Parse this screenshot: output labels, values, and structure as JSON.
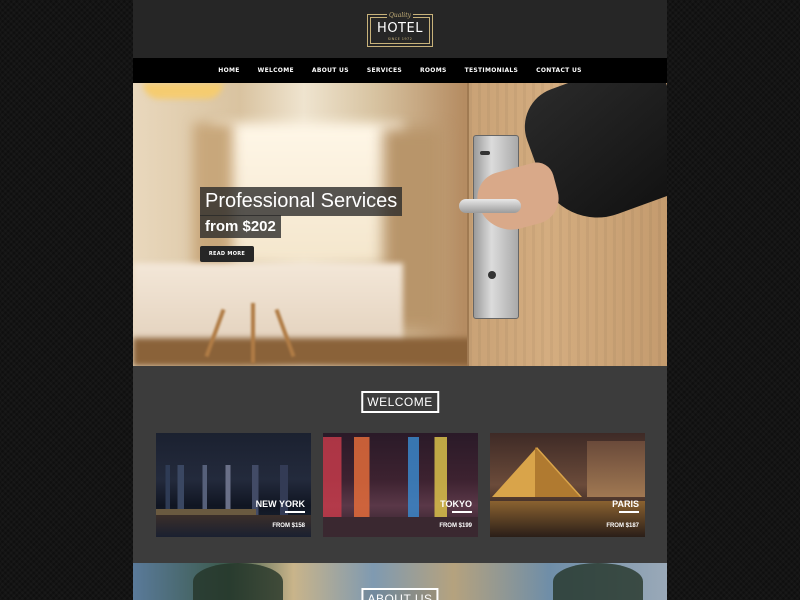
{
  "header": {
    "logo": {
      "tagline": "Quality",
      "name": "HOTEL",
      "since": "SINCE 1972"
    }
  },
  "nav": {
    "items": [
      {
        "label": "HOME"
      },
      {
        "label": "WELCOME"
      },
      {
        "label": "ABOUT US"
      },
      {
        "label": "SERVICES"
      },
      {
        "label": "ROOMS"
      },
      {
        "label": "TESTIMONIALS"
      },
      {
        "label": "CONTACT US"
      }
    ]
  },
  "hero": {
    "title": "Professional Services",
    "price": "from $202",
    "button_label": "READ MORE"
  },
  "welcome": {
    "title": "WELCOME",
    "cards": [
      {
        "city": "NEW YORK",
        "price": "FROM $158"
      },
      {
        "city": "TOKYO",
        "price": "FROM $199"
      },
      {
        "city": "PARIS",
        "price": "FROM $187"
      }
    ]
  },
  "about": {
    "title": "ABOUT US"
  },
  "colors": {
    "accent_gold": "#c8b27a",
    "nav_bg": "#000000",
    "page_bg": "#3c3c3c"
  }
}
